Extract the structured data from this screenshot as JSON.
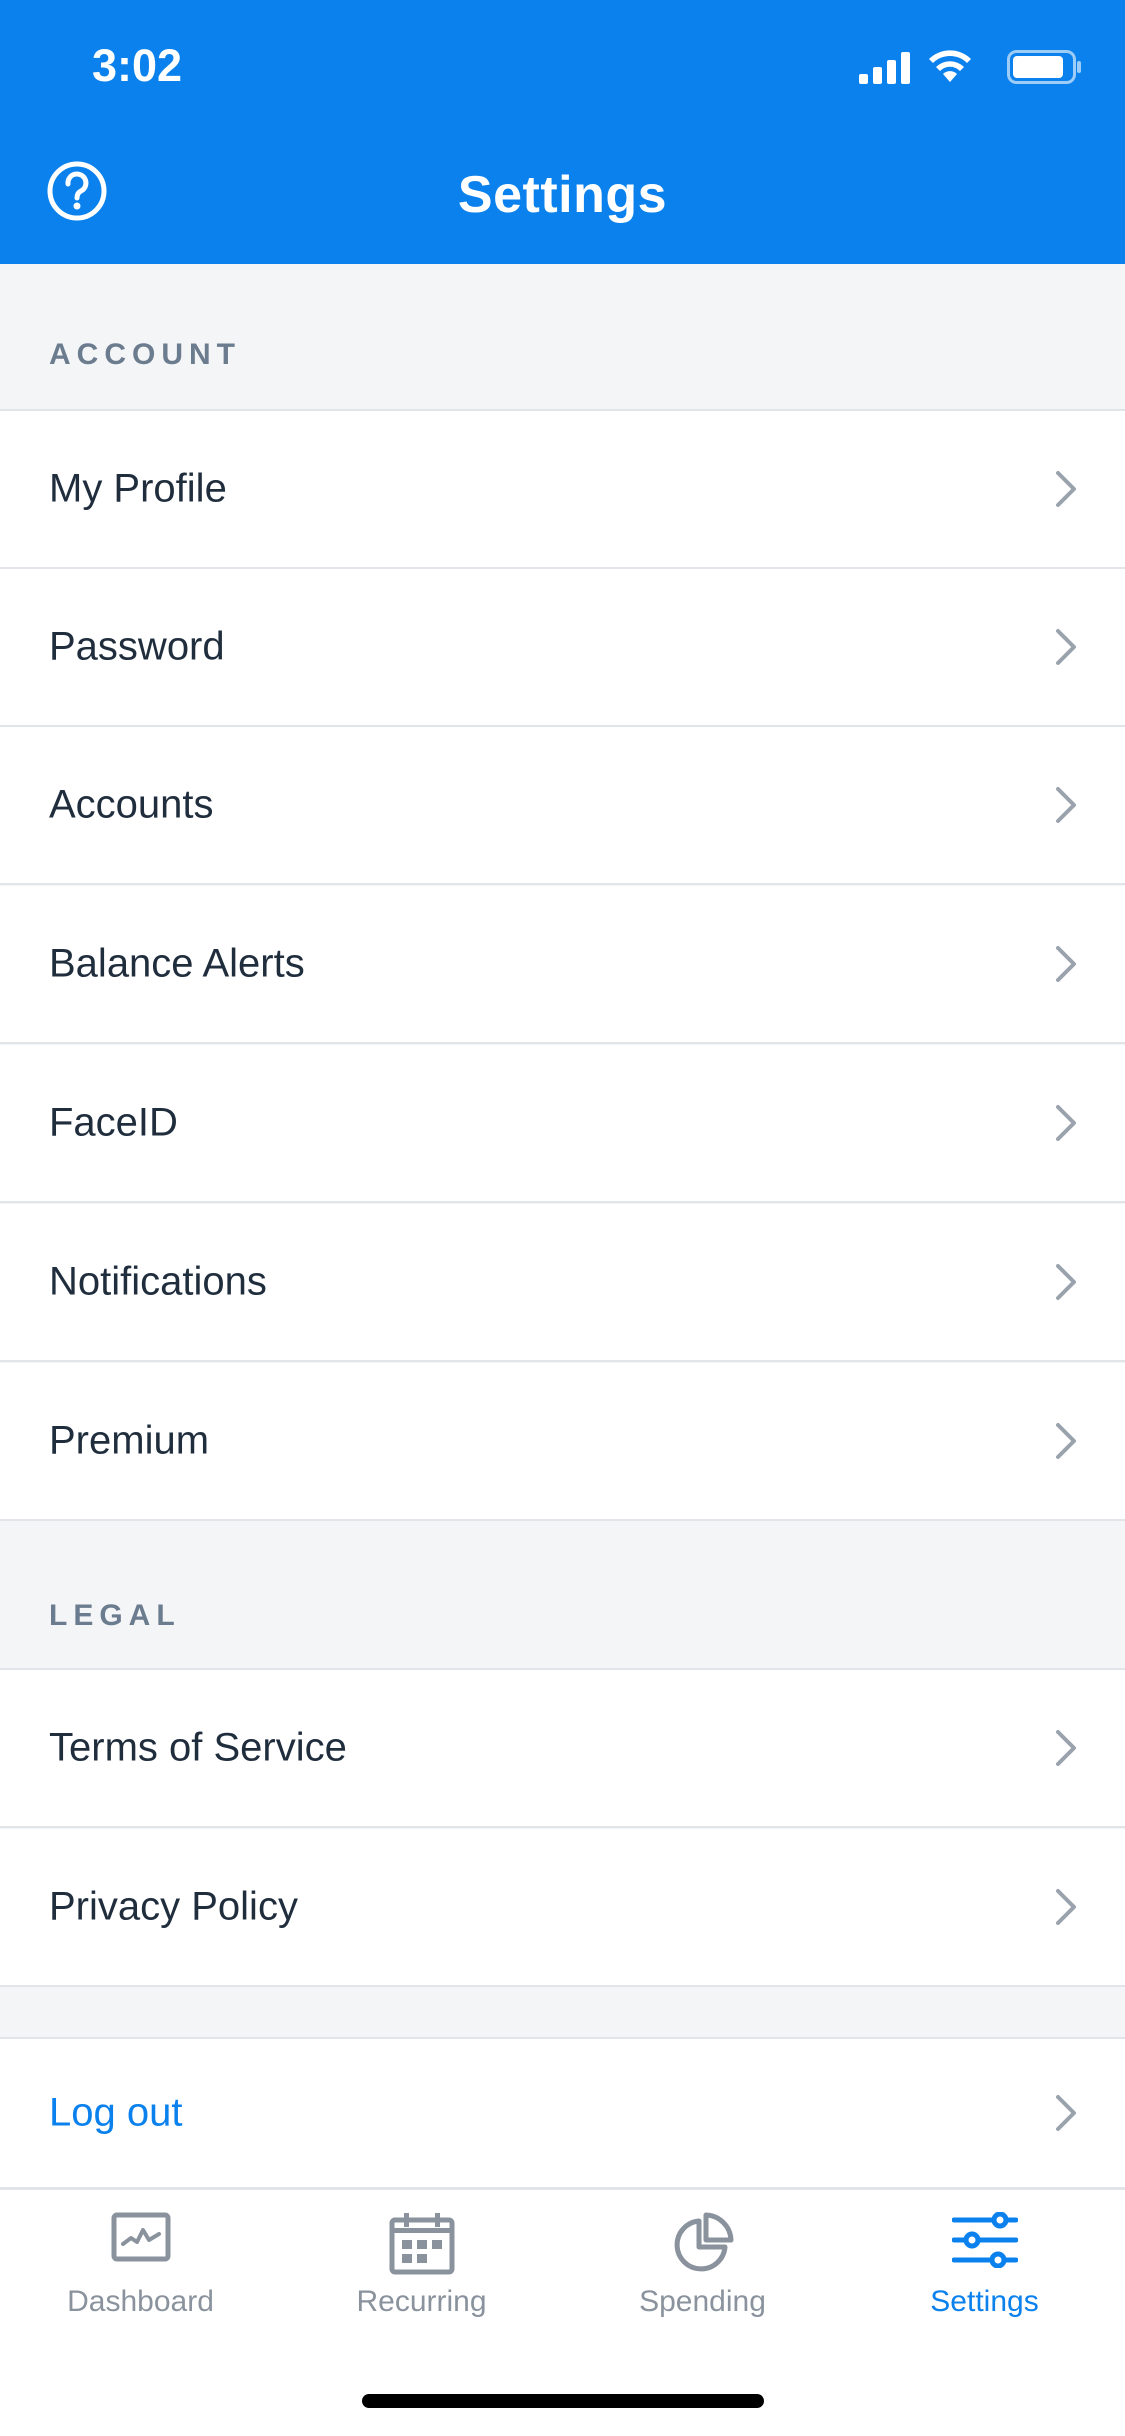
{
  "status_bar": {
    "time": "3:02"
  },
  "header": {
    "title": "Settings",
    "help_icon": "question-circle-icon"
  },
  "sections": {
    "account": {
      "title": "ACCOUNT",
      "items": [
        "My Profile",
        "Password",
        "Accounts",
        "Balance Alerts",
        "FaceID",
        "Notifications",
        "Premium"
      ]
    },
    "legal": {
      "title": "LEGAL",
      "items": [
        "Terms of Service",
        "Privacy Policy"
      ]
    },
    "logout": {
      "label": "Log out"
    }
  },
  "tab_bar": {
    "tabs": [
      {
        "label": "Dashboard",
        "icon": "chart-icon",
        "active": false
      },
      {
        "label": "Recurring",
        "icon": "calendar-icon",
        "active": false
      },
      {
        "label": "Spending",
        "icon": "pie-chart-icon",
        "active": false
      },
      {
        "label": "Settings",
        "icon": "sliders-icon",
        "active": true
      }
    ]
  },
  "colors": {
    "accent": "#0a81ec",
    "background": "#f4f5f7",
    "text": "#1f2d3d",
    "muted": "#6b7c8f"
  }
}
